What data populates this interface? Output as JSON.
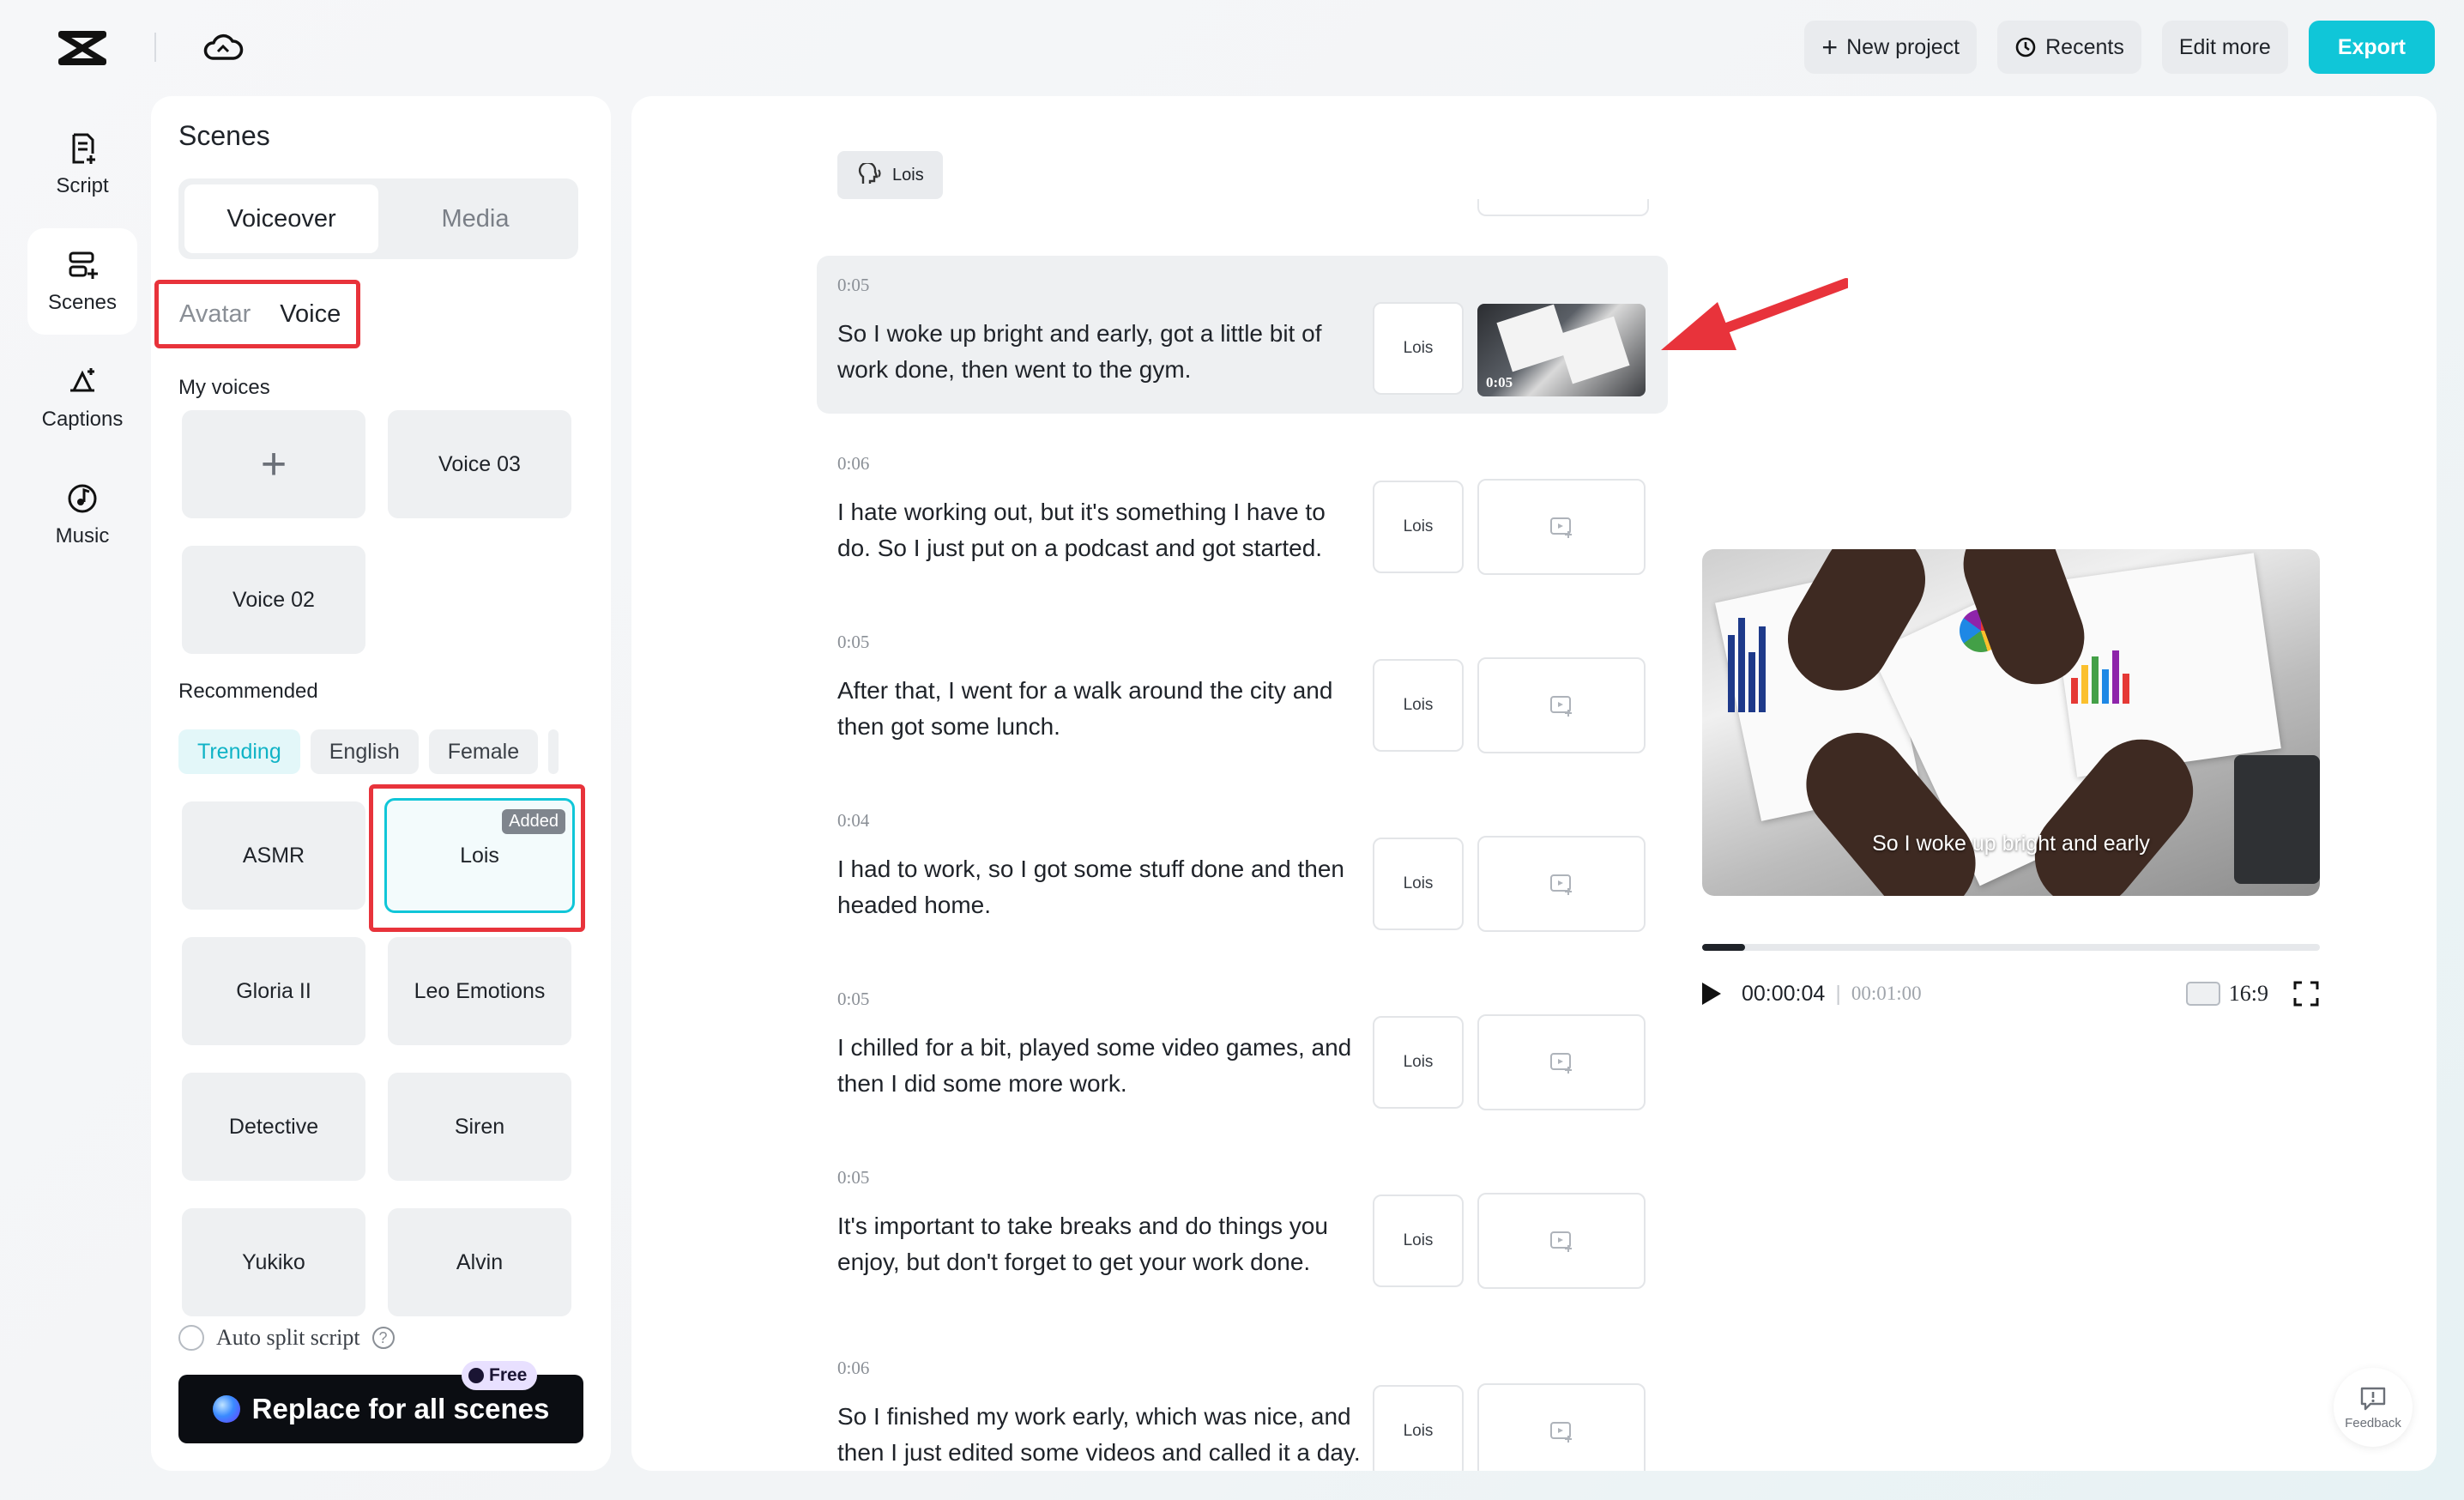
{
  "header": {
    "new_project": "New project",
    "recents": "Recents",
    "edit_more": "Edit more",
    "export": "Export",
    "accent": "#10c6d8"
  },
  "rail": {
    "items": [
      {
        "label": "Script",
        "icon": "script-icon"
      },
      {
        "label": "Scenes",
        "icon": "scenes-icon"
      },
      {
        "label": "Captions",
        "icon": "captions-icon"
      },
      {
        "label": "Music",
        "icon": "music-icon"
      }
    ]
  },
  "scenes_panel": {
    "title": "Scenes",
    "seg_voiceover": "Voiceover",
    "seg_media": "Media",
    "sub_avatar": "Avatar",
    "sub_voice": "Voice",
    "my_voices_label": "My voices",
    "plus": "+",
    "my_voices": [
      "Voice 03",
      "Voice 02"
    ],
    "recommended_label": "Recommended",
    "chips": [
      "Trending",
      "English",
      "Female"
    ],
    "recommended": [
      "ASMR",
      "Lois",
      "Gloria II",
      "Leo Emotions",
      "Detective",
      "Siren",
      "Yukiko",
      "Alvin"
    ],
    "added_badge": "Added",
    "auto_split": "Auto split script",
    "help": "?",
    "replace_btn": "Replace for all scenes",
    "free_tag": "Free"
  },
  "script": {
    "voice_chip": "Lois",
    "scenes": [
      {
        "dur": "0:05",
        "voice": "Lois",
        "text": "So I woke up bright and early, got a little bit of work done, then went to the gym.",
        "thumb_dur": "0:05"
      },
      {
        "dur": "0:06",
        "voice": "Lois",
        "text": "I hate working out, but it's something I have to do. So I just put on a podcast and got started."
      },
      {
        "dur": "0:05",
        "voice": "Lois",
        "text": "After that, I went for a walk around the city and then got some lunch."
      },
      {
        "dur": "0:04",
        "voice": "Lois",
        "text": "I had to work, so I got some stuff done and then headed home."
      },
      {
        "dur": "0:05",
        "voice": "Lois",
        "text": "I chilled for a bit, played some video games, and then I did some more work."
      },
      {
        "dur": "0:05",
        "voice": "Lois",
        "text": "It's important to take breaks and do things you enjoy, but don't forget to get your work done."
      },
      {
        "dur": "0:06",
        "voice": "Lois",
        "text": "So I finished my work early, which was nice, and then I just edited some videos and called it a day."
      }
    ]
  },
  "preview": {
    "caption": "So I woke up bright and early",
    "current_time": "00:00:04",
    "total_time": "00:01:00",
    "progress": 0.07,
    "ratio": "16:9"
  },
  "feedback": "Feedback"
}
